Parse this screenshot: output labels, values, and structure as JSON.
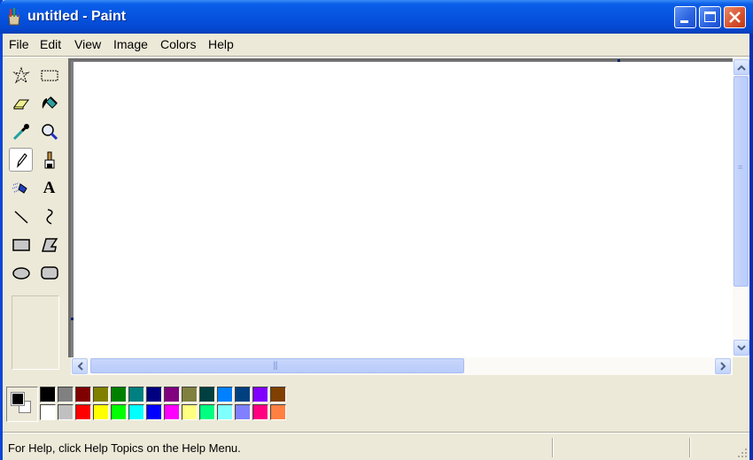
{
  "window": {
    "title": "untitled - Paint",
    "icon": "paint-app-icon",
    "controls": [
      "minimize",
      "maximize",
      "close"
    ]
  },
  "menu": [
    {
      "label": "File"
    },
    {
      "label": "Edit"
    },
    {
      "label": "View"
    },
    {
      "label": "Image"
    },
    {
      "label": "Colors"
    },
    {
      "label": "Help"
    }
  ],
  "tools": [
    {
      "name": "free-form-select",
      "icon": "free-form-select-icon"
    },
    {
      "name": "select",
      "icon": "rectangle-select-icon"
    },
    {
      "name": "eraser",
      "icon": "eraser-icon"
    },
    {
      "name": "fill-with-color",
      "icon": "paint-bucket-icon"
    },
    {
      "name": "pick-color",
      "icon": "eyedropper-icon"
    },
    {
      "name": "magnifier",
      "icon": "magnifier-icon"
    },
    {
      "name": "pencil",
      "icon": "pencil-icon",
      "active": true
    },
    {
      "name": "brush",
      "icon": "brush-icon"
    },
    {
      "name": "airbrush",
      "icon": "airbrush-icon"
    },
    {
      "name": "text",
      "icon": "text-icon",
      "glyph": "A"
    },
    {
      "name": "line",
      "icon": "line-icon"
    },
    {
      "name": "curve",
      "icon": "curve-icon"
    },
    {
      "name": "rectangle",
      "icon": "rectangle-icon"
    },
    {
      "name": "polygon",
      "icon": "polygon-icon"
    },
    {
      "name": "ellipse",
      "icon": "ellipse-icon"
    },
    {
      "name": "rounded-rectangle",
      "icon": "rounded-rectangle-icon"
    }
  ],
  "colors": {
    "foreground": "#000000",
    "background": "#ffffff",
    "palette_top": [
      "#000000",
      "#808080",
      "#800000",
      "#808000",
      "#008000",
      "#008080",
      "#000080",
      "#800080",
      "#808040",
      "#004040",
      "#0080ff",
      "#004080",
      "#8000ff",
      "#804000"
    ],
    "palette_bottom": [
      "#ffffff",
      "#c0c0c0",
      "#ff0000",
      "#ffff00",
      "#00ff00",
      "#00ffff",
      "#0000ff",
      "#ff00ff",
      "#ffff80",
      "#00ff80",
      "#80ffff",
      "#8080ff",
      "#ff0080",
      "#ff8040"
    ]
  },
  "status": {
    "help_text": "For Help, click Help Topics on the Help Menu."
  }
}
